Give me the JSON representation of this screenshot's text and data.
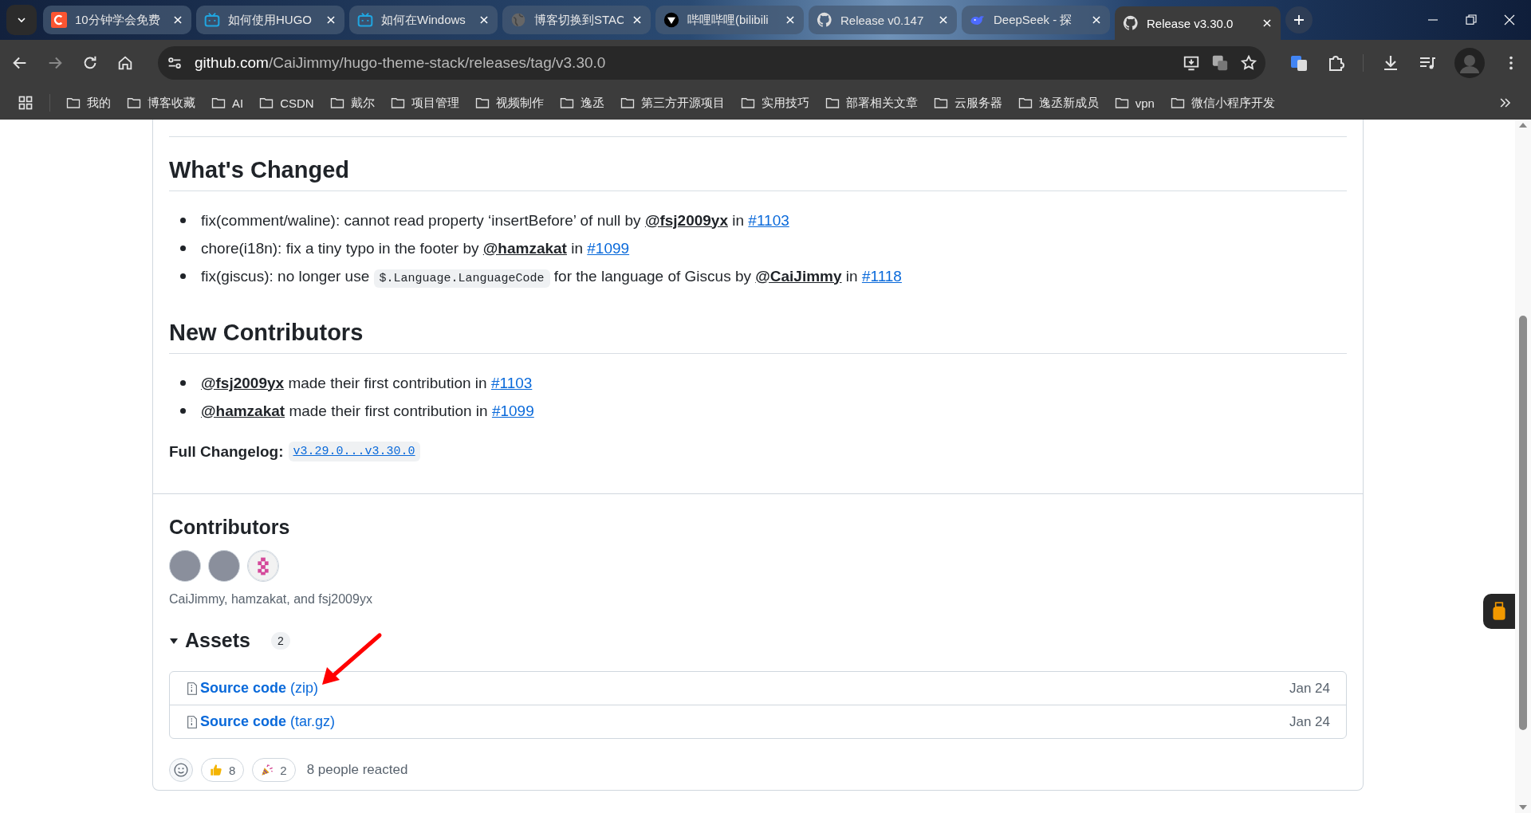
{
  "tabs": [
    {
      "title": "10分钟学会免费",
      "kind": "c-logo",
      "selected": false
    },
    {
      "title": "如何使用HUGO",
      "kind": "tv",
      "selected": false
    },
    {
      "title": "如何在Windows",
      "kind": "tv",
      "selected": false
    },
    {
      "title": "博客切换到STAC",
      "kind": "globe",
      "selected": false
    },
    {
      "title": "哔哩哔哩(bilibili",
      "kind": "triangle",
      "selected": false
    },
    {
      "title": "Release v0.147",
      "kind": "cat",
      "selected": false
    },
    {
      "title": "DeepSeek - 探",
      "kind": "whale",
      "selected": false
    },
    {
      "title": "Release v3.30.0",
      "kind": "cat",
      "selected": true
    }
  ],
  "address": {
    "host": "github.com",
    "path": "/CaiJimmy/hugo-theme-stack/releases/tag/v3.30.0"
  },
  "bookmarks": [
    "我的",
    "博客收藏",
    "AI",
    "CSDN",
    "戴尔",
    "项目管理",
    "视频制作",
    "逸丞",
    "第三方开源项目",
    "实用技巧",
    "部署相关文章",
    "云服务器",
    "逸丞新成员",
    "vpn",
    "微信小程序开发"
  ],
  "whats_changed": {
    "title": "What's Changed",
    "items": [
      [
        {
          "kind": "text",
          "text": "fix(comment/waline): cannot read property ‘insertBefore’ of null by "
        },
        {
          "kind": "user",
          "text": "@fsj2009yx"
        },
        {
          "kind": "text",
          "text": " in "
        },
        {
          "kind": "issue",
          "text": "#1103"
        }
      ],
      [
        {
          "kind": "text",
          "text": "chore(i18n): fix a tiny typo in the footer by "
        },
        {
          "kind": "user",
          "text": "@hamzakat"
        },
        {
          "kind": "text",
          "text": " in "
        },
        {
          "kind": "issue",
          "text": "#1099"
        }
      ],
      [
        {
          "kind": "text",
          "text": "fix(giscus): no longer use "
        },
        {
          "kind": "code",
          "text": "$.Language.LanguageCode"
        },
        {
          "kind": "text",
          "text": " for the language of Giscus by "
        },
        {
          "kind": "user",
          "text": "@CaiJimmy"
        },
        {
          "kind": "text",
          "text": " in "
        },
        {
          "kind": "issue",
          "text": "#1118"
        }
      ]
    ]
  },
  "new_contributors": {
    "title": "New Contributors",
    "items": [
      [
        {
          "kind": "user",
          "text": "@fsj2009yx"
        },
        {
          "kind": "text",
          "text": " made their first contribution in "
        },
        {
          "kind": "issue",
          "text": "#1103"
        }
      ],
      [
        {
          "kind": "user",
          "text": "@hamzakat"
        },
        {
          "kind": "text",
          "text": " made their first contribution in "
        },
        {
          "kind": "issue",
          "text": "#1099"
        }
      ]
    ]
  },
  "full_changelog": {
    "label": "Full Changelog:",
    "link": "v3.29.0...v3.30.0"
  },
  "contributors": {
    "title": "Contributors",
    "avatars": [
      {
        "kind": "photo"
      },
      {
        "kind": "photo"
      },
      {
        "kind": "identicon"
      }
    ],
    "names": "CaiJimmy, hamzakat, and fsj2009yx"
  },
  "assets": {
    "title": "Assets",
    "count": "2",
    "expanded": true,
    "items": [
      {
        "name": "Source code",
        "format": "(zip)",
        "date": "Jan 24"
      },
      {
        "name": "Source code",
        "format": "(tar.gz)",
        "date": "Jan 24"
      }
    ]
  },
  "reactions": {
    "items": [
      {
        "kind": "thumbs_up",
        "count": "8"
      },
      {
        "kind": "party",
        "count": "2"
      }
    ],
    "summary": "8 people reacted"
  }
}
